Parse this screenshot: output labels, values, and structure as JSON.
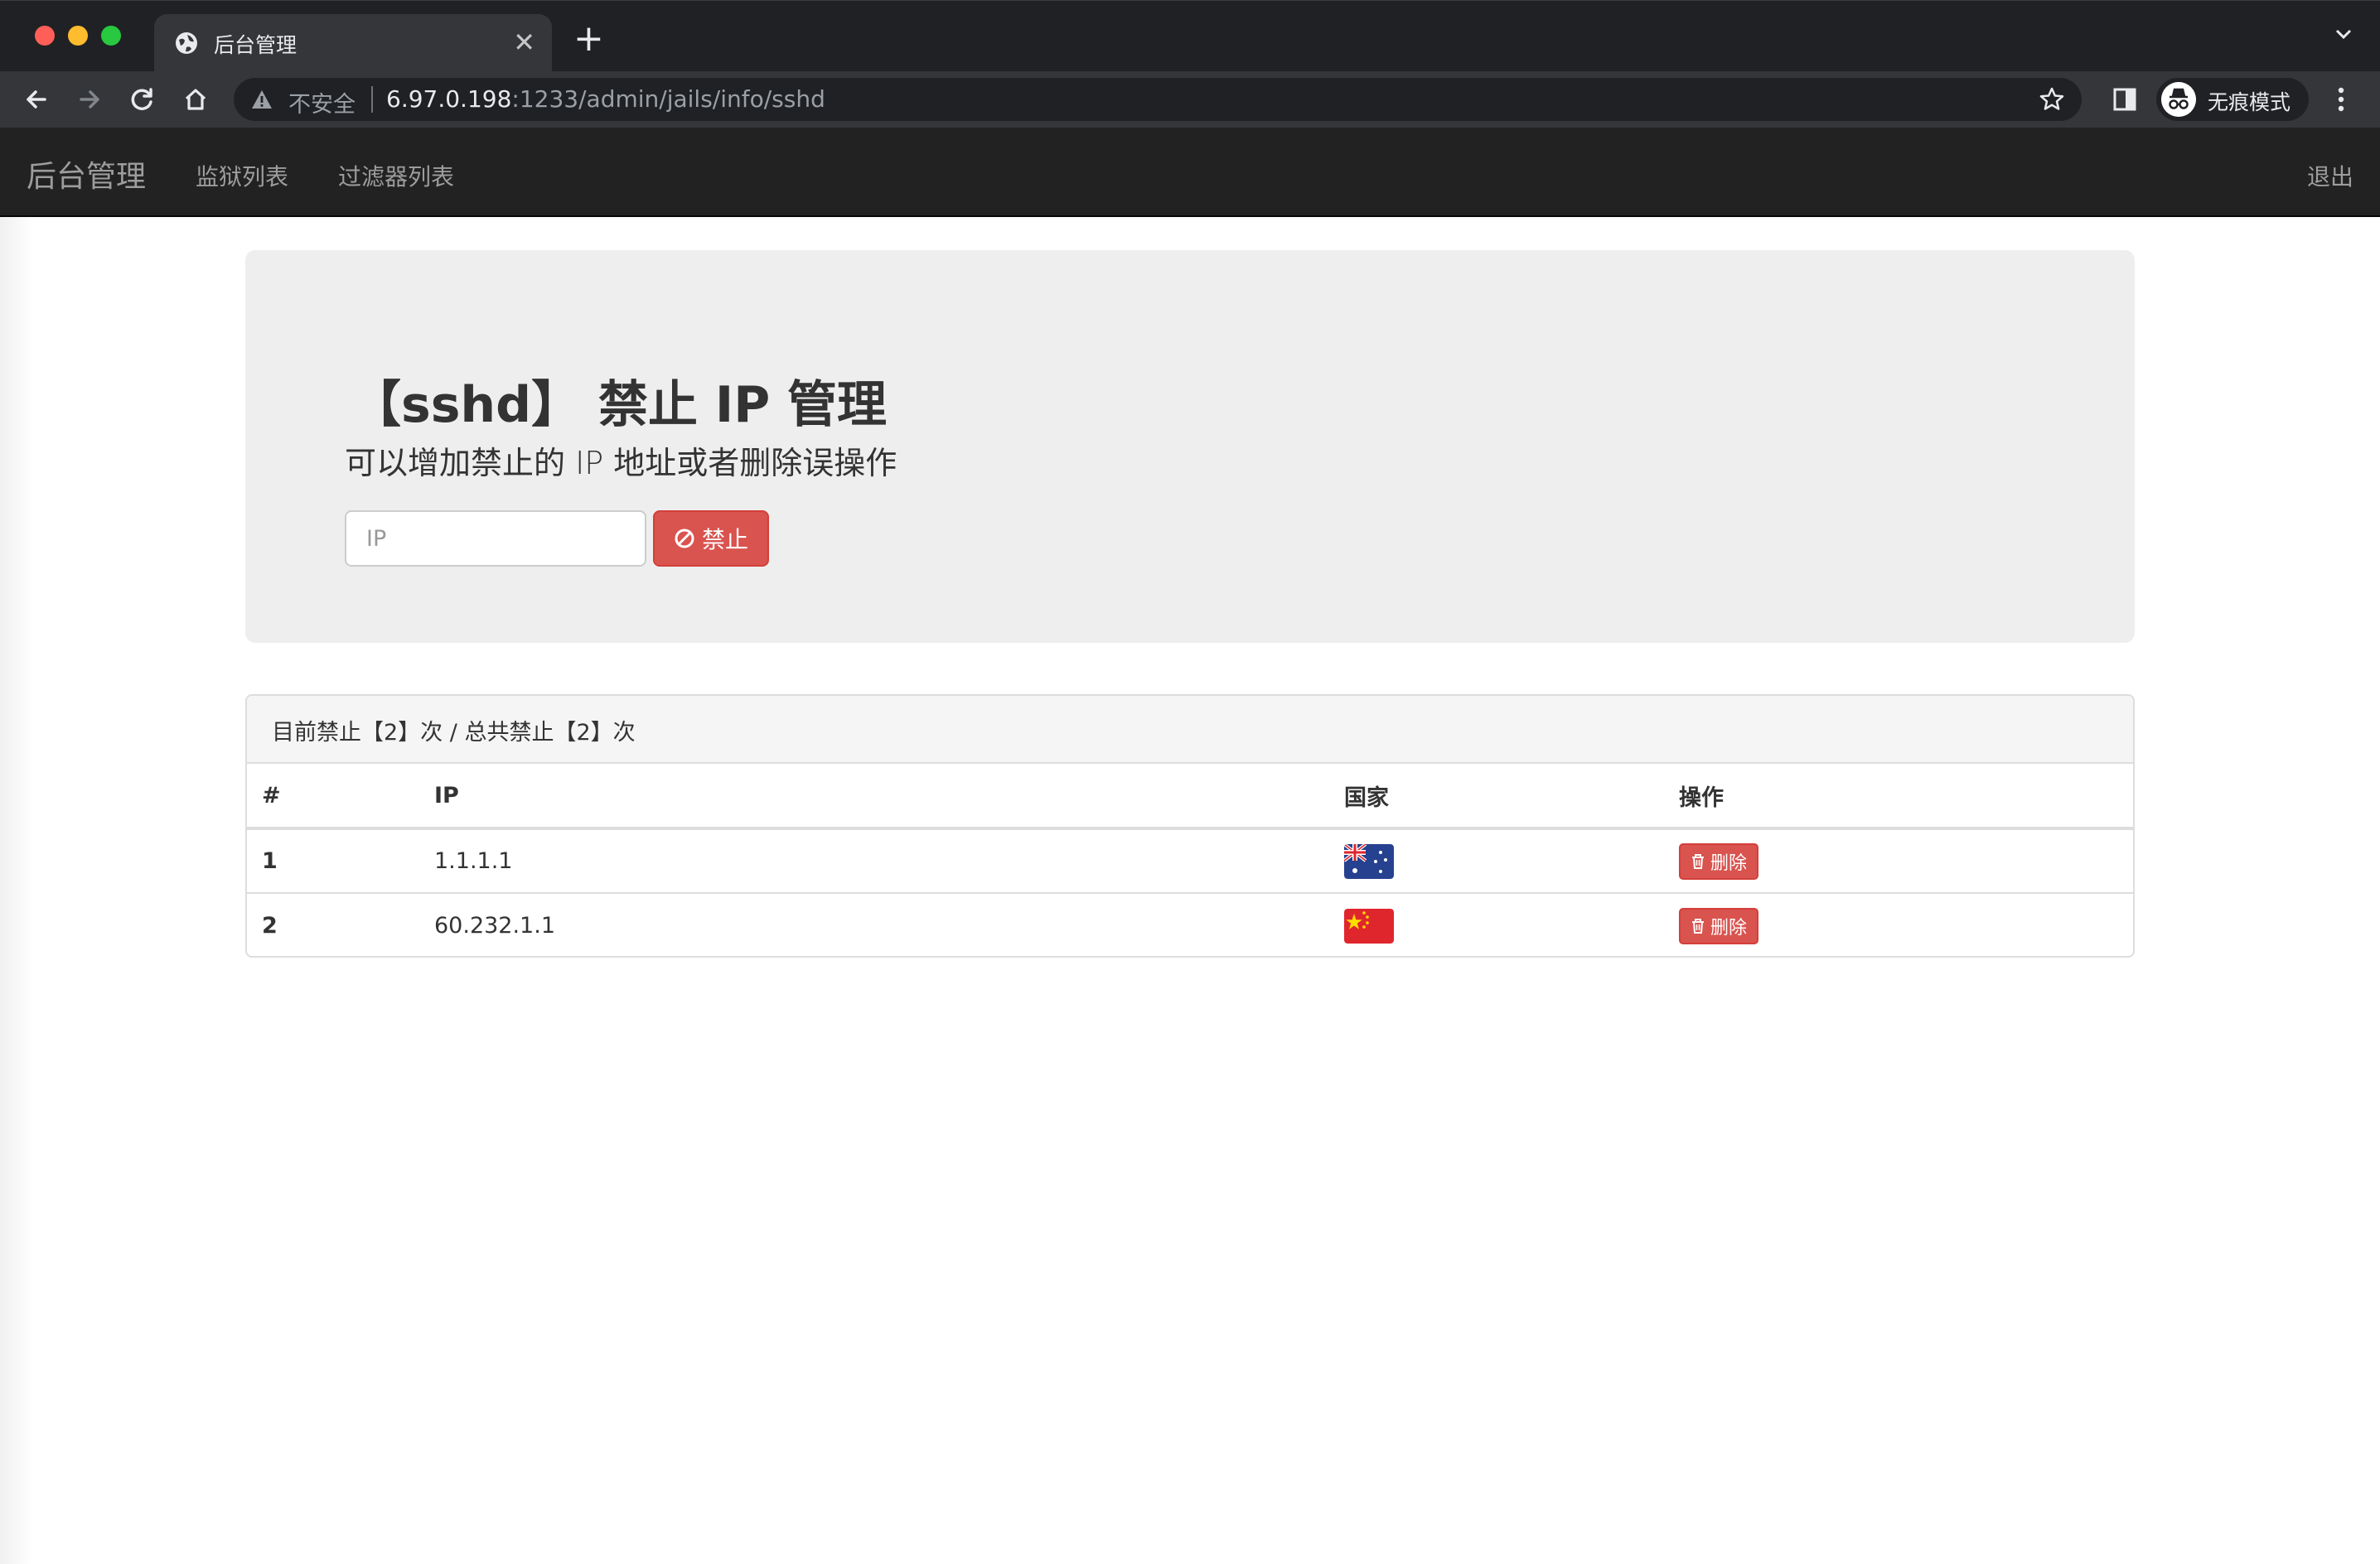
{
  "browser": {
    "tab_title": "后台管理",
    "tab_close": "✕",
    "new_tab": "+",
    "omnibox": {
      "security_label": "不安全",
      "url_host": "6.97.0.198",
      "url_path": ":1233/admin/jails/info/sshd"
    },
    "profile_label": "无痕模式"
  },
  "navbar": {
    "brand": "后台管理",
    "links": [
      "监狱列表",
      "过滤器列表"
    ],
    "logout": "退出"
  },
  "jumbotron": {
    "title": "【sshd】 禁止 IP 管理",
    "subtitle": "可以增加禁止的 IP 地址或者删除误操作",
    "ip_placeholder": "IP",
    "ban_button": "禁止"
  },
  "panel": {
    "heading": "目前禁止【2】次 / 总共禁止【2】次",
    "columns": [
      "#",
      "IP",
      "国家",
      "操作"
    ],
    "rows": [
      {
        "num": "1",
        "ip": "1.1.1.1",
        "country_flag": "australia-flag",
        "action": "删除"
      },
      {
        "num": "2",
        "ip": "60.232.1.1",
        "country_flag": "china-flag",
        "action": "删除"
      }
    ]
  },
  "colors": {
    "danger": "#d9534f",
    "navbar": "#222222",
    "jumbotron": "#eeeeee"
  }
}
